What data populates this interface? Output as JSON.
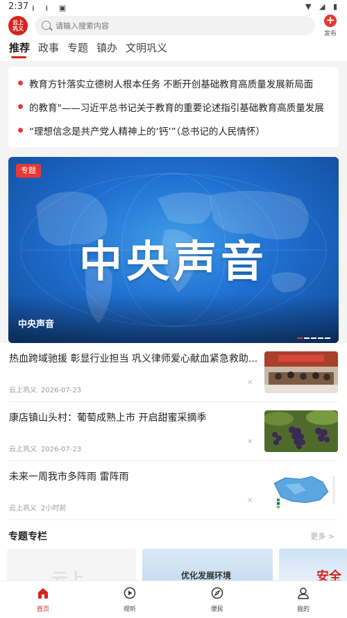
{
  "status_bar": {
    "time": "2:37",
    "left_icons": "⭳ ⭳ ▣",
    "right_icons": "▼ ◢ ▮"
  },
  "header": {
    "logo_text": "云上巩义",
    "search_placeholder": "请输入搜索内容",
    "publish_label": "发布"
  },
  "tabs": [
    {
      "label": "推荐",
      "active": true
    },
    {
      "label": "政事"
    },
    {
      "label": "专题"
    },
    {
      "label": "镇办"
    },
    {
      "label": "文明巩义"
    }
  ],
  "headlines": [
    "教育方针落实立德树人根本任务 不断开创基础教育高质量发展新局面",
    "的教育\"——习近平总书记关于教育的重要论述指引基础教育高质量发展",
    "“理想信念是共产党人精神上的‘钙’”（总书记的人民情怀）"
  ],
  "banner": {
    "tag": "专题",
    "big_text": "中央声音",
    "caption": "中央声音",
    "active_dot": 0,
    "dot_count": 5
  },
  "news": [
    {
      "title": "热血跨域驰援 彰显行业担当 巩义律师爱心献血紧急救助...",
      "source": "云上巩义",
      "time": "2026-07-23",
      "thumb": "meeting-photo"
    },
    {
      "title": "康店镇山头村：葡萄成熟上市 开启甜蜜采摘季",
      "source": "云上巩义",
      "time": "2026-07-23",
      "thumb": "grapes-photo"
    },
    {
      "title": "未来一周我市多阵雨 雷阵雨",
      "source": "云上巩义",
      "time": "2小时前",
      "thumb": "weather-map"
    }
  ],
  "special_section": {
    "title": "专题专栏",
    "more": "更多 >",
    "cards": [
      {
        "text": "云上"
      },
      {
        "text": "优化发展环境"
      },
      {
        "text": "安全"
      }
    ]
  },
  "bottom_nav": [
    {
      "label": "首页",
      "icon": "home-icon",
      "active": true
    },
    {
      "label": "视听",
      "icon": "play-icon"
    },
    {
      "label": "便民",
      "icon": "compass-icon"
    },
    {
      "label": "我的",
      "icon": "user-icon"
    }
  ],
  "colors": {
    "brand_red": "#d6231d",
    "accent_red": "#e53935",
    "banner_blue": "#1f6fd0"
  }
}
